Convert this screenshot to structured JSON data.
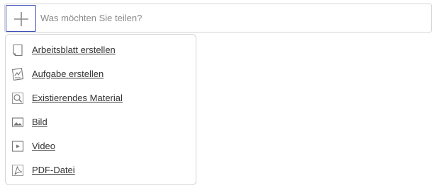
{
  "composer": {
    "add_button_icon": "plus-icon",
    "placeholder": "Was möchten Sie teilen?",
    "value": ""
  },
  "menu": {
    "items": [
      {
        "label": "Arbeitsblatt erstellen",
        "icon": "worksheet-icon"
      },
      {
        "label": "Aufgabe erstellen",
        "icon": "task-icon"
      },
      {
        "label": "Existierendes Material",
        "icon": "search-material-icon"
      },
      {
        "label": "Bild",
        "icon": "image-icon"
      },
      {
        "label": "Video",
        "icon": "video-icon"
      },
      {
        "label": "PDF-Datei",
        "icon": "pdf-icon"
      }
    ]
  },
  "colors": {
    "accent_border": "#3f4fb8",
    "border": "#d5d5d5",
    "text": "#333333",
    "placeholder": "#8a8a8a",
    "icon": "#777777"
  }
}
